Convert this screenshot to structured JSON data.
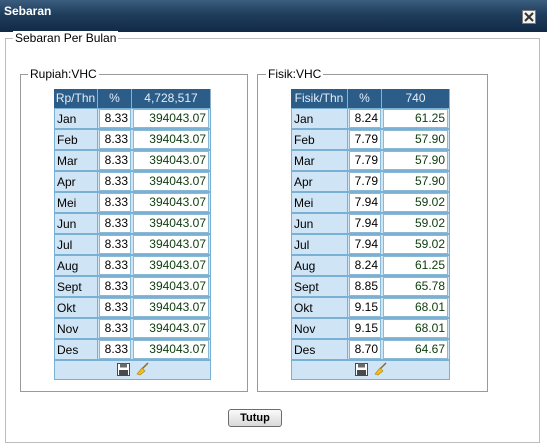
{
  "window": {
    "title": "Sebaran"
  },
  "outer_legend": "Sebaran Per Bulan",
  "rupiah": {
    "legend": "Rupiah:VHC",
    "headers": [
      "Rp/Thn",
      "%",
      "4,728,517"
    ],
    "rows": [
      {
        "month": "Jan",
        "pct": "8.33",
        "value": "394043.07"
      },
      {
        "month": "Feb",
        "pct": "8.33",
        "value": "394043.07"
      },
      {
        "month": "Mar",
        "pct": "8.33",
        "value": "394043.07"
      },
      {
        "month": "Apr",
        "pct": "8.33",
        "value": "394043.07"
      },
      {
        "month": "Mei",
        "pct": "8.33",
        "value": "394043.07"
      },
      {
        "month": "Jun",
        "pct": "8.33",
        "value": "394043.07"
      },
      {
        "month": "Jul",
        "pct": "8.33",
        "value": "394043.07"
      },
      {
        "month": "Aug",
        "pct": "8.33",
        "value": "394043.07"
      },
      {
        "month": "Sept",
        "pct": "8.33",
        "value": "394043.07"
      },
      {
        "month": "Okt",
        "pct": "8.33",
        "value": "394043.07"
      },
      {
        "month": "Nov",
        "pct": "8.33",
        "value": "394043.07"
      },
      {
        "month": "Des",
        "pct": "8.33",
        "value": "394043.07"
      }
    ]
  },
  "fisik": {
    "legend": "Fisik:VHC",
    "headers": [
      "Fisik/Thn",
      "%",
      "740"
    ],
    "rows": [
      {
        "month": "Jan",
        "pct": "8.24",
        "value": "61.25"
      },
      {
        "month": "Feb",
        "pct": "7.79",
        "value": "57.90"
      },
      {
        "month": "Mar",
        "pct": "7.79",
        "value": "57.90"
      },
      {
        "month": "Apr",
        "pct": "7.79",
        "value": "57.90"
      },
      {
        "month": "Mei",
        "pct": "7.94",
        "value": "59.02"
      },
      {
        "month": "Jun",
        "pct": "7.94",
        "value": "59.02"
      },
      {
        "month": "Jul",
        "pct": "7.94",
        "value": "59.02"
      },
      {
        "month": "Aug",
        "pct": "8.24",
        "value": "61.25"
      },
      {
        "month": "Sept",
        "pct": "8.85",
        "value": "65.78"
      },
      {
        "month": "Okt",
        "pct": "9.15",
        "value": "68.01"
      },
      {
        "month": "Nov",
        "pct": "9.15",
        "value": "68.01"
      },
      {
        "month": "Des",
        "pct": "8.70",
        "value": "64.67"
      }
    ]
  },
  "icons": {
    "save": "floppy-disk-icon",
    "clear": "broom-icon",
    "close": "close-icon"
  },
  "colors": {
    "titlebar": "#1f3d5c",
    "header": "#2c5c88",
    "month_cell": "#cfe4f4",
    "value_text": "#0c3b0c"
  },
  "buttons": {
    "close_label": "Tutup"
  }
}
